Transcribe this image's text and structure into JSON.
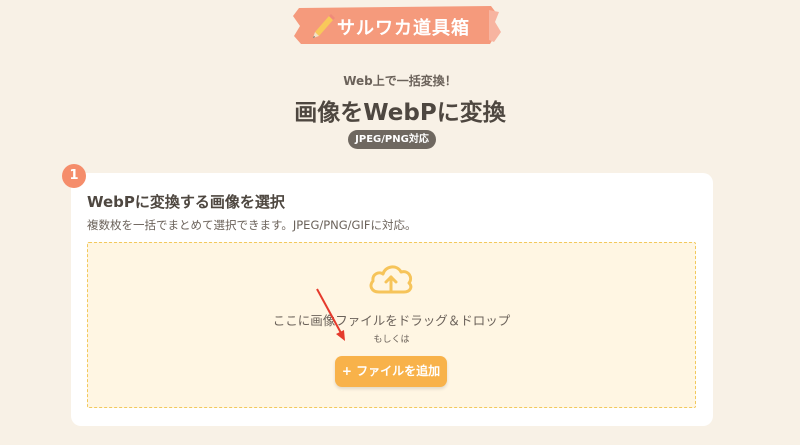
{
  "brand": {
    "logo_text": "サルワカ道具箱",
    "colors": {
      "banner": "#f59a7c",
      "accent_orange": "#f8b24a",
      "step": "#f58d6b",
      "background": "#f8f1e6"
    }
  },
  "hero": {
    "subtitle": "Web上で一括変換！",
    "title": "画像をWebPに変換",
    "badge": "JPEG/PNG対応"
  },
  "step": {
    "number": "1",
    "title": "WebPに変換する画像を選択",
    "description": "複数枚を一括でまとめて選択できます。JPEG/PNG/GIFに対応。"
  },
  "dropzone": {
    "icon": "cloud-upload-icon",
    "text": "ここに画像ファイルをドラッグ＆ドロップ",
    "or_text": "もしくは",
    "add_button_label": "+ ファイルを追加"
  }
}
